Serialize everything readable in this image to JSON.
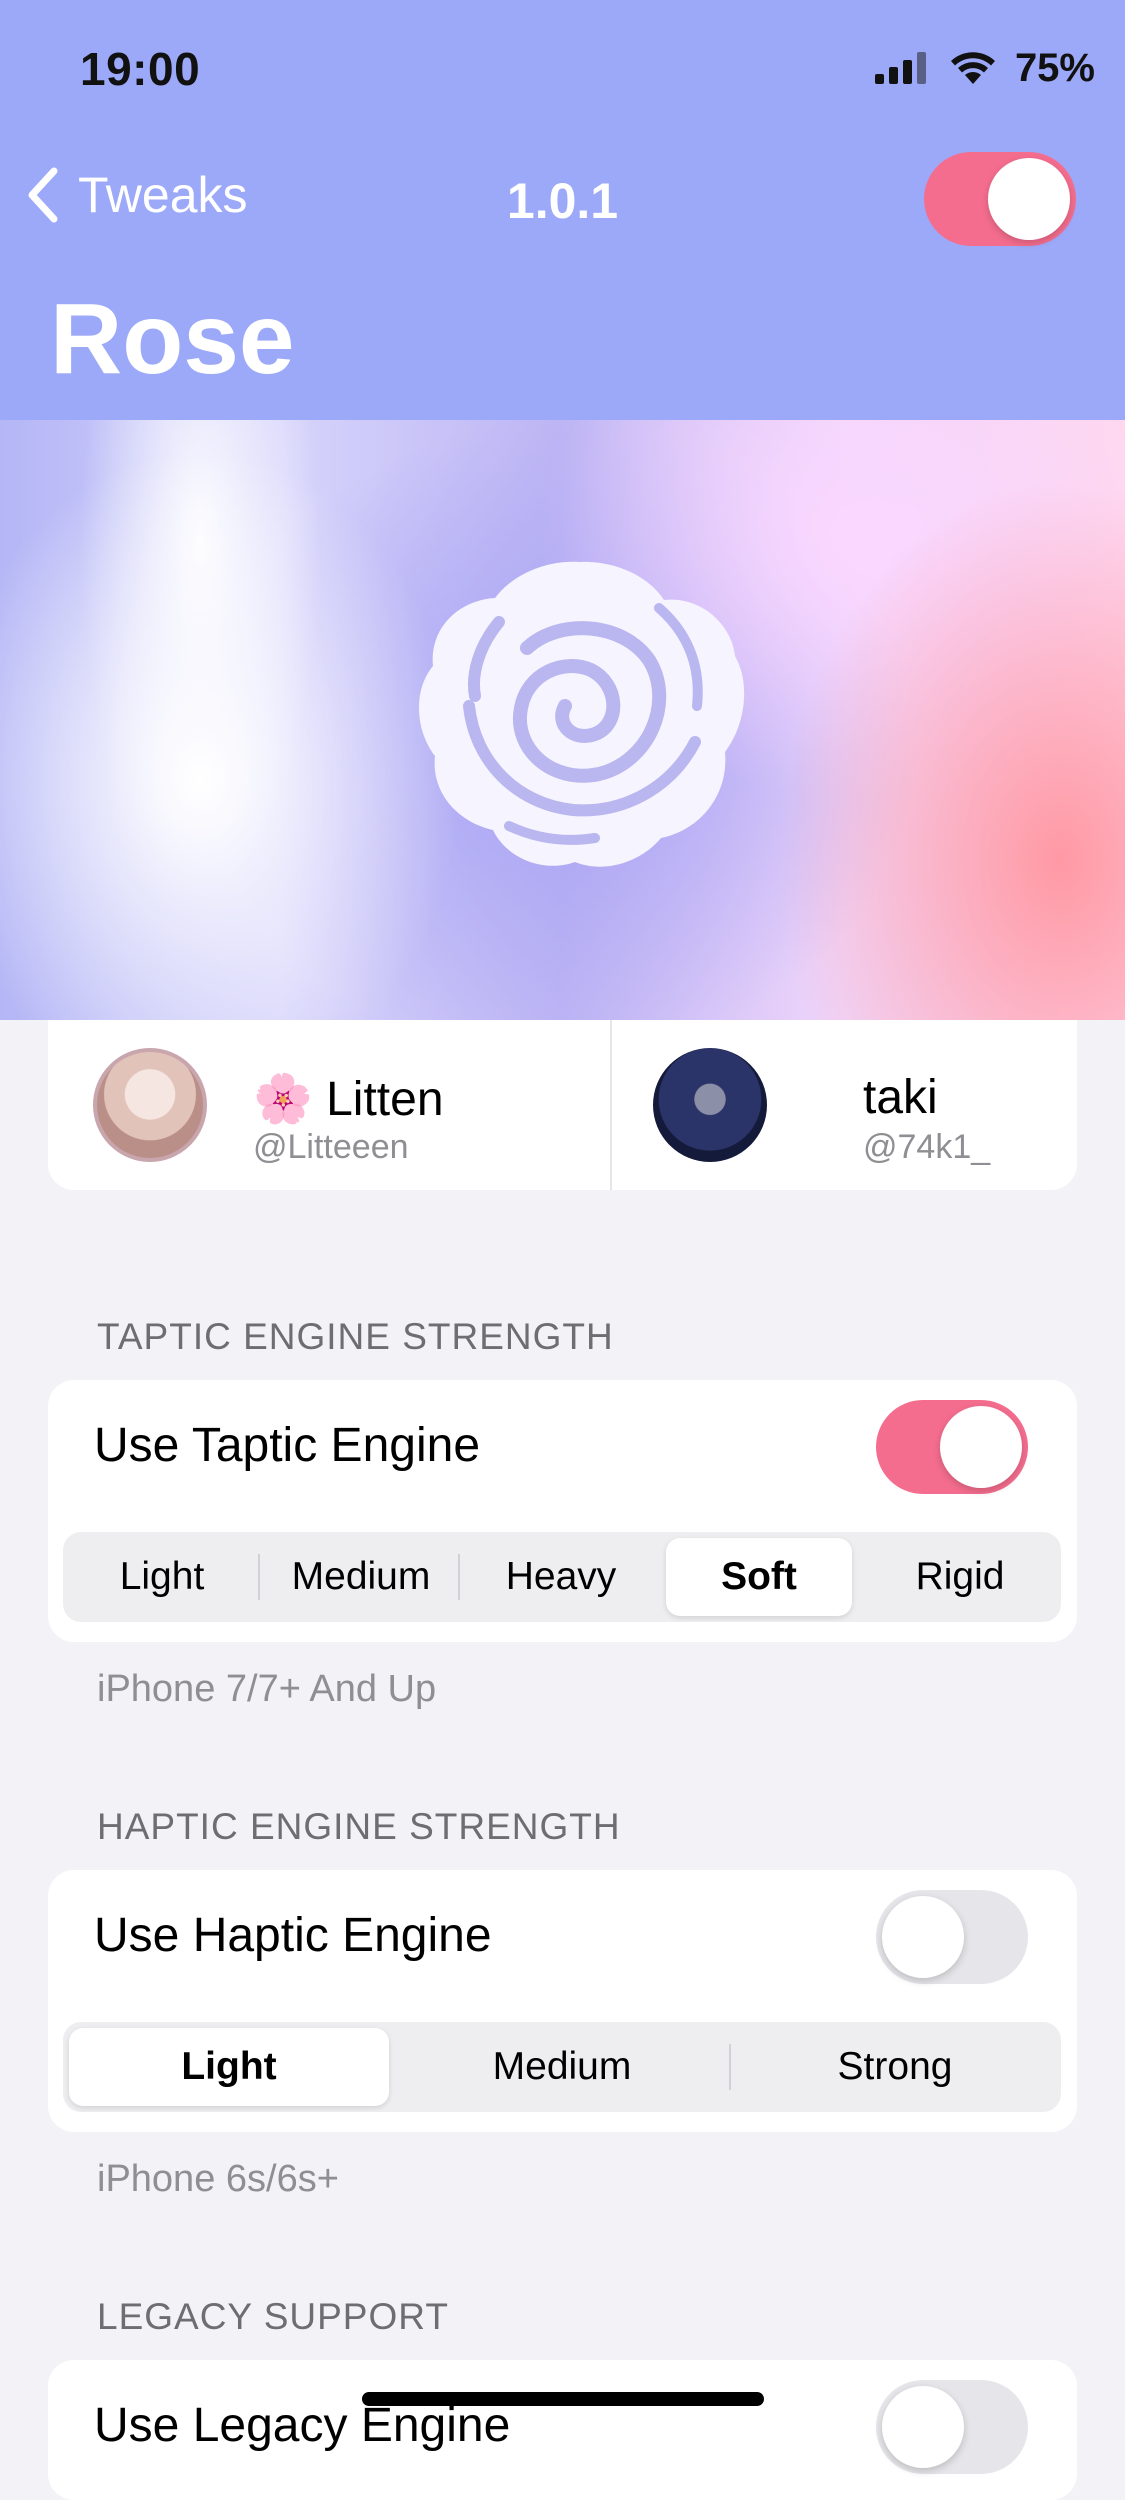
{
  "status_bar": {
    "time": "19:00",
    "battery": "75%"
  },
  "nav": {
    "back_label": "Tweaks",
    "version": "1.0.1",
    "enabled": true
  },
  "title": "Rose",
  "developers": [
    {
      "emoji": "🌸",
      "name": "Litten",
      "handle": "@Litteeen"
    },
    {
      "name": "taki",
      "handle": "@74k1_"
    }
  ],
  "taptic": {
    "header": "TAPTIC ENGINE STRENGTH",
    "toggle_label": "Use Taptic Engine",
    "enabled": true,
    "options": [
      "Light",
      "Medium",
      "Heavy",
      "Soft",
      "Rigid"
    ],
    "selected": "Soft",
    "footer": "iPhone 7/7+ And Up"
  },
  "haptic": {
    "header": "HAPTIC ENGINE STRENGTH",
    "toggle_label": "Use Haptic Engine",
    "enabled": false,
    "options": [
      "Light",
      "Medium",
      "Strong"
    ],
    "selected": "Light",
    "footer": "iPhone 6s/6s+"
  },
  "legacy": {
    "header": "LEGACY SUPPORT",
    "toggle_label": "Use Legacy Engine",
    "enabled": false
  },
  "colors": {
    "header_bg": "#9ca9f8",
    "accent": "#f56d8e"
  }
}
